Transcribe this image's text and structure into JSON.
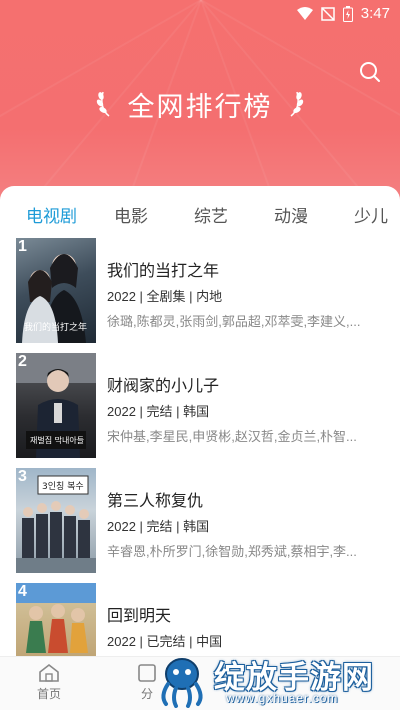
{
  "status_bar": {
    "time": "3:47"
  },
  "header": {
    "title": "全网排行榜"
  },
  "tabs": [
    {
      "label": "电视剧",
      "active": true
    },
    {
      "label": "电影",
      "active": false
    },
    {
      "label": "综艺",
      "active": false
    },
    {
      "label": "动漫",
      "active": false
    },
    {
      "label": "少儿",
      "active": false
    }
  ],
  "items": [
    {
      "rank": "1",
      "title": "我们的当打之年",
      "meta": "2022 | 全剧集 | 内地",
      "cast": "徐璐,陈都灵,张雨剑,郭品超,邓萃雯,李建义,..."
    },
    {
      "rank": "2",
      "title": "财阀家的小儿子",
      "meta": "2022 | 完结 | 韩国",
      "cast": "宋仲基,李星民,申贤彬,赵汉哲,金贞兰,朴智..."
    },
    {
      "rank": "3",
      "title": "第三人称复仇",
      "meta": "2022 | 完结 | 韩国",
      "cast": "辛睿恩,朴所罗门,徐智勋,郑秀斌,蔡相宇,李..."
    },
    {
      "rank": "4",
      "title": "回到明天",
      "meta": "2022 | 已完结 | 中国",
      "cast": ""
    }
  ],
  "bottom_nav": [
    {
      "label": "首页",
      "icon": "home-icon"
    },
    {
      "label": "分",
      "icon": "category-icon"
    }
  ],
  "watermark": {
    "text": "绽放手游网",
    "url": "www.gxhuaer.com"
  },
  "colors": {
    "header": "#f5706f",
    "active_tab": "#1e9bd7",
    "watermark": "#1c5f9d"
  }
}
